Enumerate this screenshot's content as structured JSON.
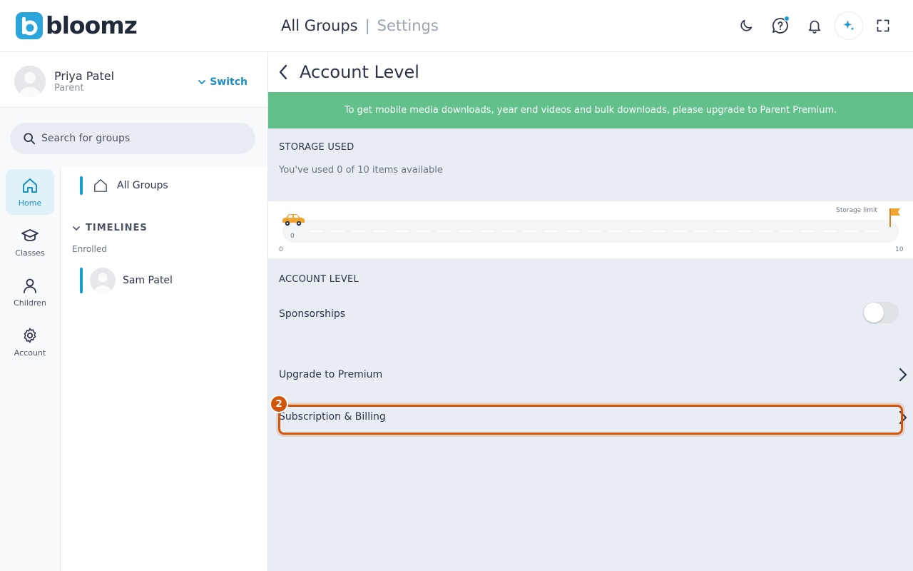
{
  "app": {
    "logo_text": "bloomz",
    "logo_letter": "b",
    "brand_color": "#2aa6dc"
  },
  "header": {
    "title": "All Groups",
    "separator": "|",
    "subtitle": "Settings",
    "icons": [
      "moon-icon",
      "help-chat-icon",
      "bell-icon",
      "sparkle-icon",
      "fullscreen-icon"
    ]
  },
  "profile": {
    "name": "Priya Patel",
    "role": "Parent",
    "switch_label": "Switch"
  },
  "search": {
    "placeholder": "Search for groups"
  },
  "nav": {
    "items": [
      {
        "label": "Home",
        "icon": "home-icon",
        "active": true
      },
      {
        "label": "Classes",
        "icon": "graduation-cap-icon",
        "active": false
      },
      {
        "label": "Children",
        "icon": "person-icon",
        "active": false
      },
      {
        "label": "Account",
        "icon": "gear-icon",
        "active": false
      }
    ]
  },
  "groups": {
    "all_groups_label": "All Groups",
    "timelines_heading": "TIMELINES",
    "enrolled_label": "Enrolled",
    "children": [
      {
        "name": "Sam Patel"
      }
    ]
  },
  "page": {
    "title": "Account Level",
    "banner_text": "To get mobile media downloads, year end videos and bulk downloads, please upgrade to Parent Premium.",
    "banner_color": "#62c08a",
    "storage_heading": "STORAGE USED",
    "storage_note": "You've used 0 of 10 items available",
    "storage": {
      "used": 0,
      "limit": 10,
      "limit_label": "Storage limit",
      "min_tick": "0",
      "max_tick": "10",
      "car_value": "0"
    },
    "account_level_heading": "ACCOUNT LEVEL",
    "sponsorships_label": "Sponsorships",
    "sponsorships_enabled": false,
    "upgrade_label": "Upgrade to Premium",
    "billing_label": "Subscription & Billing",
    "step_badge": "2",
    "highlight_color": "#d2570c"
  }
}
